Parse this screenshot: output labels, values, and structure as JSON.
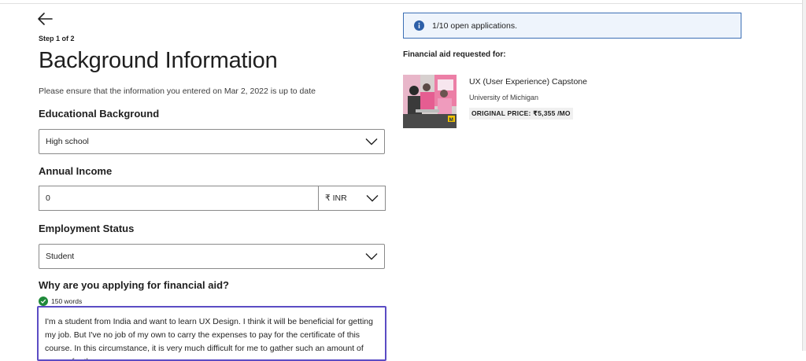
{
  "header": {
    "step": "Step 1 of 2",
    "title": "Background Information",
    "subtitle": "Please ensure that the information you entered on Mar 2, 2022 is up to date"
  },
  "form": {
    "education": {
      "label": "Educational Background",
      "value": "High school"
    },
    "income": {
      "label": "Annual Income",
      "value": "0",
      "currency": "₹ INR"
    },
    "employment": {
      "label": "Employment Status",
      "value": "Student"
    },
    "reason": {
      "label": "Why are you applying for financial aid?",
      "word_count": "150 words",
      "text": "I'm a student from India and want to learn UX Design. I think it will be beneficial for getting my job. But I've no job of my own to carry the expenses to pay for the certificate of this course. In this circumstance, it is very much difficult for me to gather such an amount of money for the"
    }
  },
  "sidebar": {
    "banner": "1/10 open applications.",
    "aid_title": "Financial aid requested for:",
    "course": {
      "name": "UX (User Experience) Capstone",
      "university": "University of Michigan",
      "price": "ORIGINAL PRICE: ₹5,355 /MO"
    }
  },
  "colors": {
    "accent_focus": "#5b4cc4",
    "info_border": "#3c6fb5",
    "info_bg": "#eef4fc",
    "success": "#1f8a3a"
  },
  "icons": [
    "back-arrow-icon",
    "chevron-down-icon",
    "info-icon",
    "check-circle-icon"
  ]
}
